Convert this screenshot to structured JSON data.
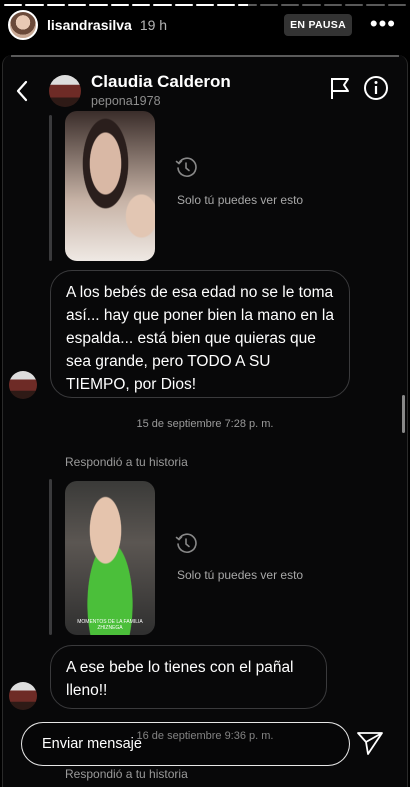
{
  "story": {
    "username": "lisandrasilva",
    "time": "19 h",
    "paused_badge": "EN PAUSA",
    "more_glyph": "•••",
    "progress_segments": [
      1,
      1,
      1,
      1,
      1,
      1,
      1,
      1,
      1,
      1,
      1,
      0.5,
      0,
      0,
      0,
      0,
      0,
      0,
      0
    ]
  },
  "dm": {
    "contact_name": "Claudia Calderon",
    "contact_username": "pepona1978",
    "only_you": "Solo tú puedes ver esto",
    "message1": "A los bebés de esa edad no se le toma así... hay que poner bien la mano en la espalda... está bien que quieras que sea grande, pero TODO A SU TIEMPO, por Dios!",
    "timestamp1": "15 de septiembre 7:28 p. m.",
    "replied1": "Respondió a tu historia",
    "thumb2_caption": "MOMENTOS DE LA FAMILIA ZHIZNEGA",
    "message2": "A ese bebe lo tienes con el pañal lleno!!",
    "timestamp2": "16 de septiembre 9:36 p. m.",
    "replied2": "Respondió a tu historia"
  },
  "composer": {
    "placeholder": "Enviar mensaje"
  },
  "icons": [
    "more-icon",
    "back-icon",
    "flag-icon",
    "info-icon",
    "clock-icon",
    "send-icon"
  ]
}
